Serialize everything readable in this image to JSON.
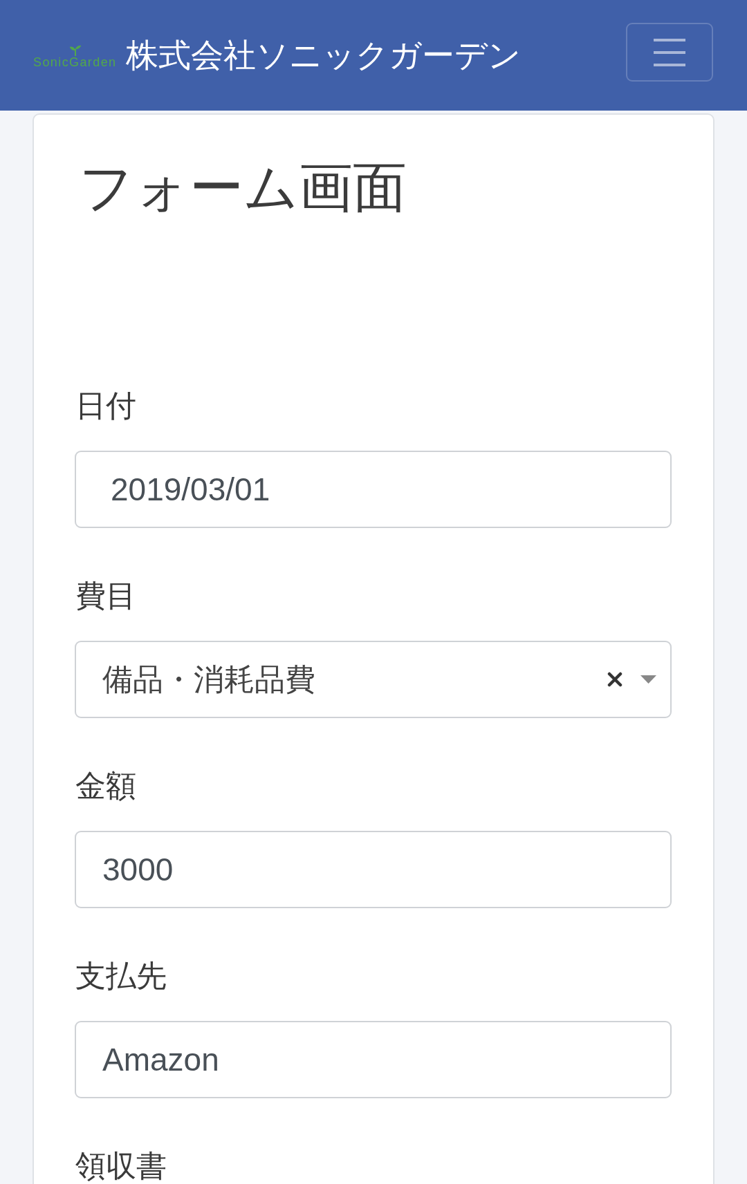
{
  "header": {
    "logo_text": "SonicGarden",
    "title": "株式会社ソニックガーデン"
  },
  "page": {
    "title": "フォーム画面"
  },
  "fields": [
    {
      "kind": "date",
      "label": "日付",
      "value": "2019/03/01"
    },
    {
      "kind": "select",
      "label": "費目",
      "value": "備品・消耗品費"
    },
    {
      "kind": "text",
      "label": "金額",
      "value": "3000"
    },
    {
      "kind": "text",
      "label": "支払先",
      "value": "Amazon"
    },
    {
      "label": "領収書"
    }
  ]
}
